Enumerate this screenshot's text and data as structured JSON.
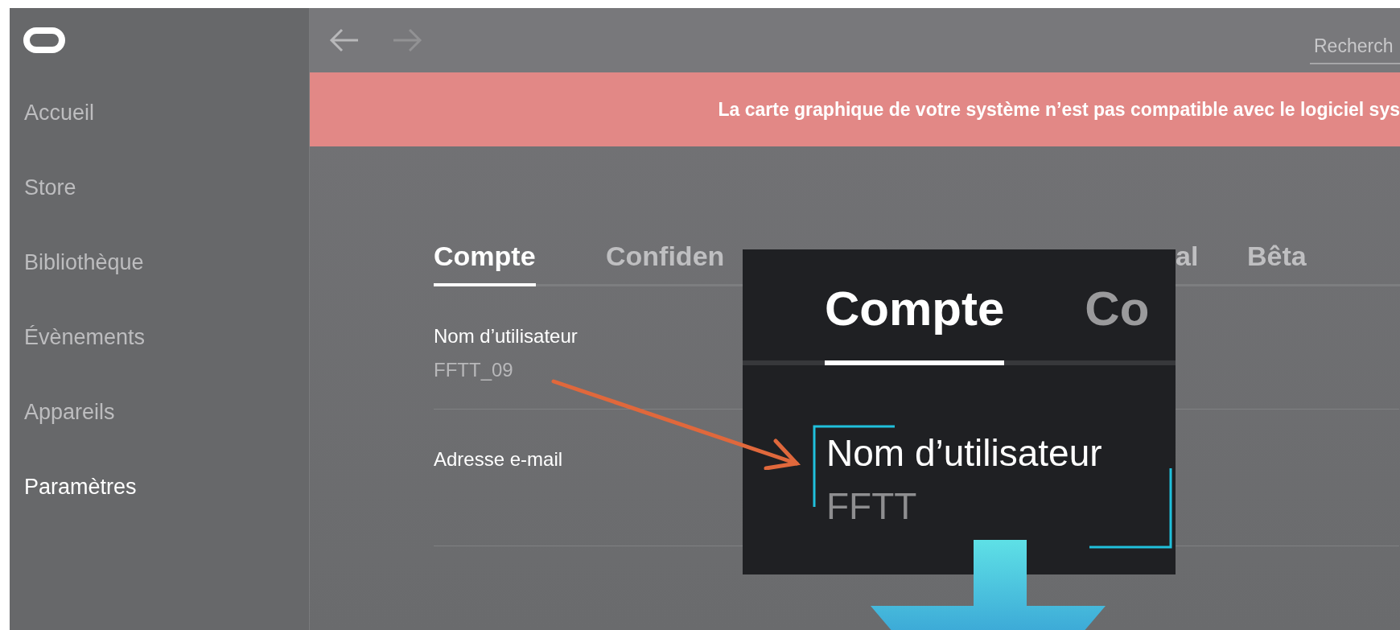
{
  "sidebar": {
    "items": [
      {
        "label": "Accueil",
        "selected": false
      },
      {
        "label": "Store",
        "selected": false
      },
      {
        "label": "Bibliothèque",
        "selected": false
      },
      {
        "label": "Évènements",
        "selected": false
      },
      {
        "label": "Appareils",
        "selected": false
      },
      {
        "label": "Paramètres",
        "selected": true
      }
    ]
  },
  "toolbar": {
    "search": {
      "placeholder": "Recherch"
    }
  },
  "banner": {
    "message": "La carte graphique de votre système n’est pas compatible avec le logiciel sys"
  },
  "tabs": [
    {
      "label": "Compte",
      "selected": true
    },
    {
      "label": "Confiden",
      "selected": false
    },
    {
      "label": "al",
      "selected": false
    },
    {
      "label": "Bêta",
      "selected": false
    }
  ],
  "fields": [
    {
      "label": "Nom d’utilisateur",
      "value": "FFTT_09"
    },
    {
      "label": "Adresse e-mail"
    }
  ],
  "zoom_inset": {
    "tab": "Compte",
    "next_tab": "Co",
    "field_label": "Nom d’utilisateur",
    "field_value": "FFTT"
  }
}
